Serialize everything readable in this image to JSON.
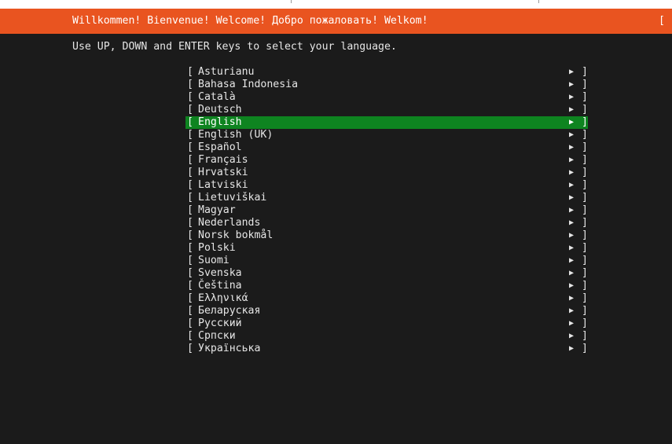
{
  "header": {
    "title": "Willkommen! Bienvenue! Welcome! Добро пожаловать! Welkom!",
    "help_bracket": "[ "
  },
  "instruction": "Use UP, DOWN and ENTER keys to select your language.",
  "languages": {
    "bracket_open": "[",
    "bracket_close": "]",
    "arrow": "▶",
    "selected": "English",
    "items": [
      "Asturianu",
      "Bahasa Indonesia",
      "Català",
      "Deutsch",
      "English",
      "English (UK)",
      "Español",
      "Français",
      "Hrvatski",
      "Latviski",
      "Lietuviškai",
      "Magyar",
      "Nederlands",
      "Norsk bokmål",
      "Polski",
      "Suomi",
      "Svenska",
      "Čeština",
      "Ελληνικά",
      "Беларуская",
      "Русский",
      "Српски",
      "Українська"
    ]
  },
  "colors": {
    "header_bar": "#e95420",
    "selection": "#0e8420",
    "background": "#1b1b1b",
    "text": "#e6e6e6"
  }
}
